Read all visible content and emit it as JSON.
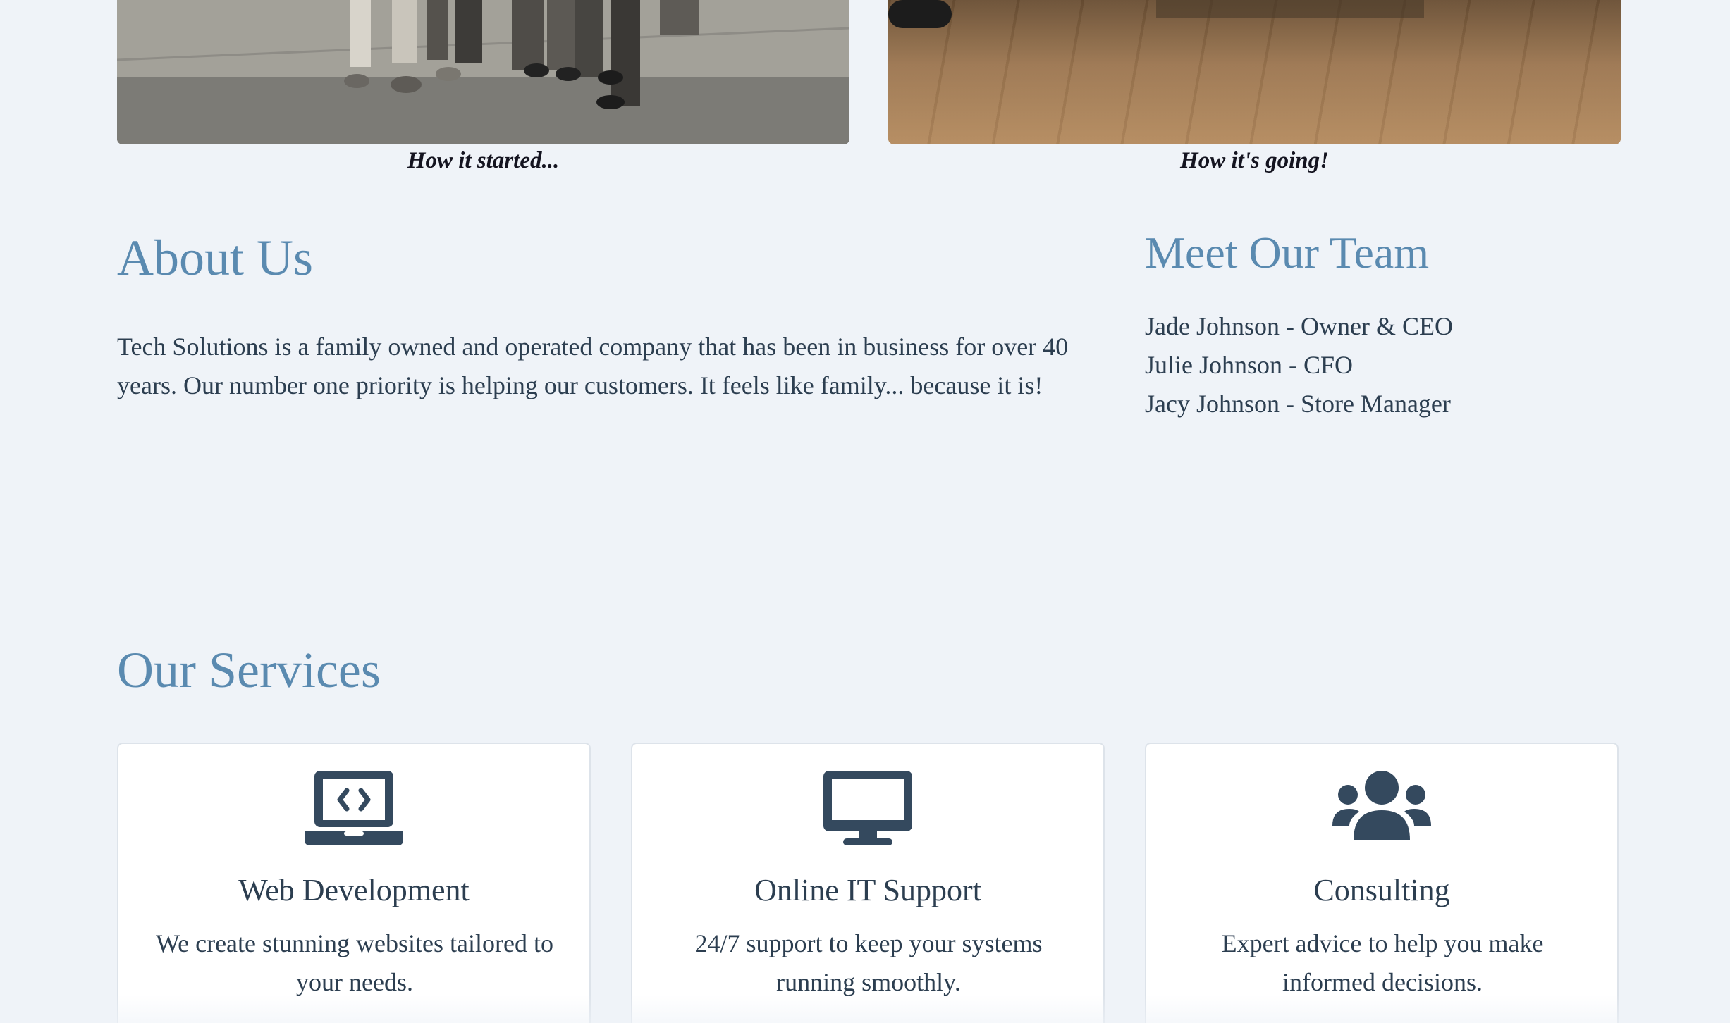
{
  "gallery": {
    "captions": [
      "How it started...",
      "How it's going!"
    ]
  },
  "about": {
    "heading": "About Us",
    "text": "Tech Solutions is a family owned and operated company that has been in business for over 40 years. Our number one priority is helping our customers. It feels like family... because it is!"
  },
  "team": {
    "heading": "Meet Our Team",
    "members": [
      "Jade Johnson - Owner & CEO",
      "Julie Johnson - CFO",
      "Jacy Johnson - Store Manager"
    ]
  },
  "services": {
    "heading": "Our Services",
    "items": [
      {
        "icon": "laptop-code-icon",
        "title": "Web Development",
        "description": "We create stunning websites tailored to your needs."
      },
      {
        "icon": "desktop-icon",
        "title": "Online IT Support",
        "description": "24/7 support to keep your systems running smoothly."
      },
      {
        "icon": "users-icon",
        "title": "Consulting",
        "description": "Expert advice to help you make informed decisions."
      }
    ]
  },
  "colors": {
    "background": "#eff3f8",
    "heading": "#5a8ab0",
    "text": "#2c3e50",
    "icon": "#34495e"
  }
}
